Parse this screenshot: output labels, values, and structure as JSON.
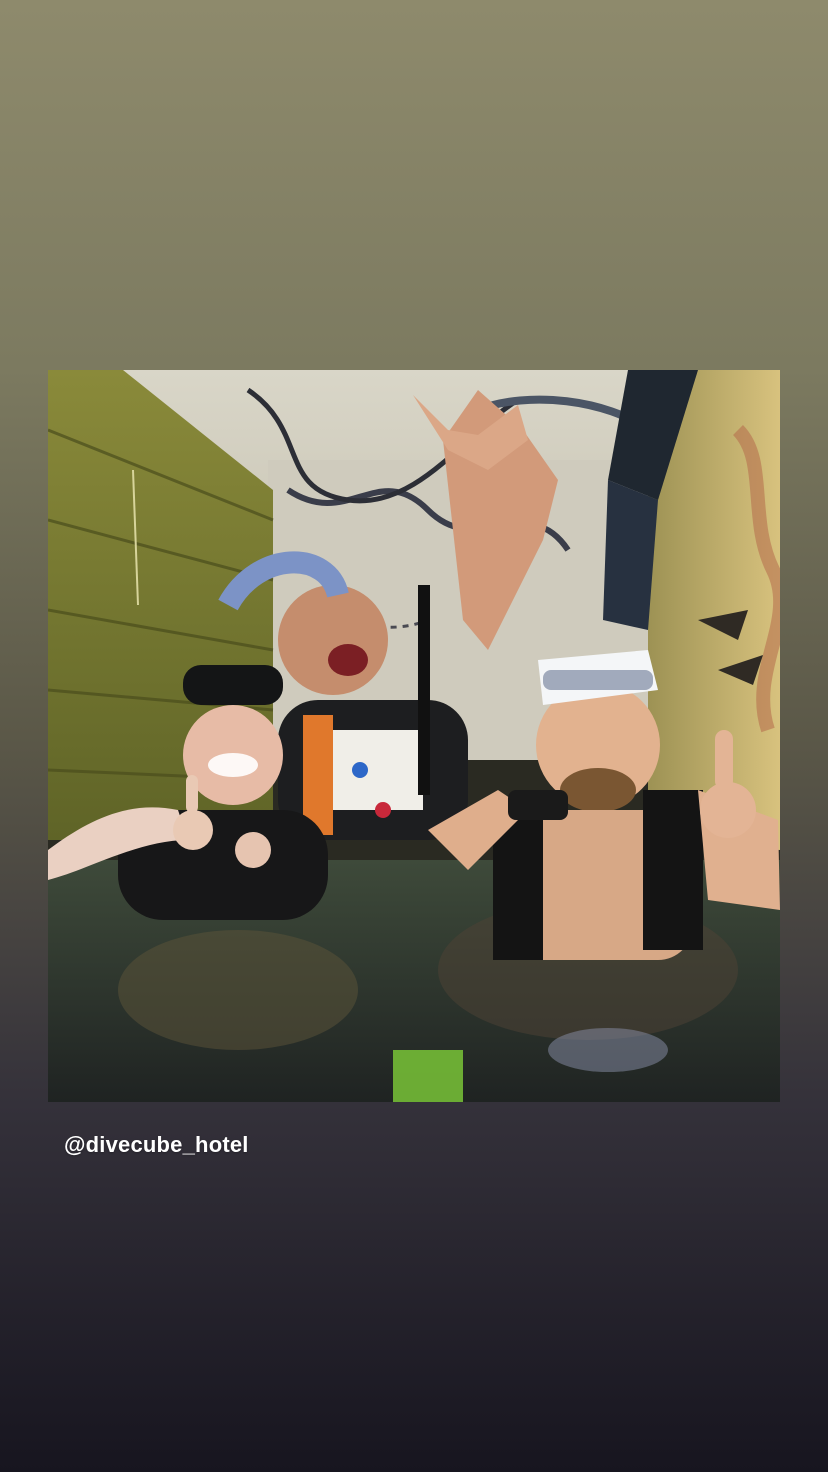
{
  "story": {
    "mention_tag": "@divecube_hotel",
    "background_top": "#8e8a6c",
    "background_bottom": "#17151f"
  },
  "photo": {
    "subject": "scuba-divers-photo"
  }
}
